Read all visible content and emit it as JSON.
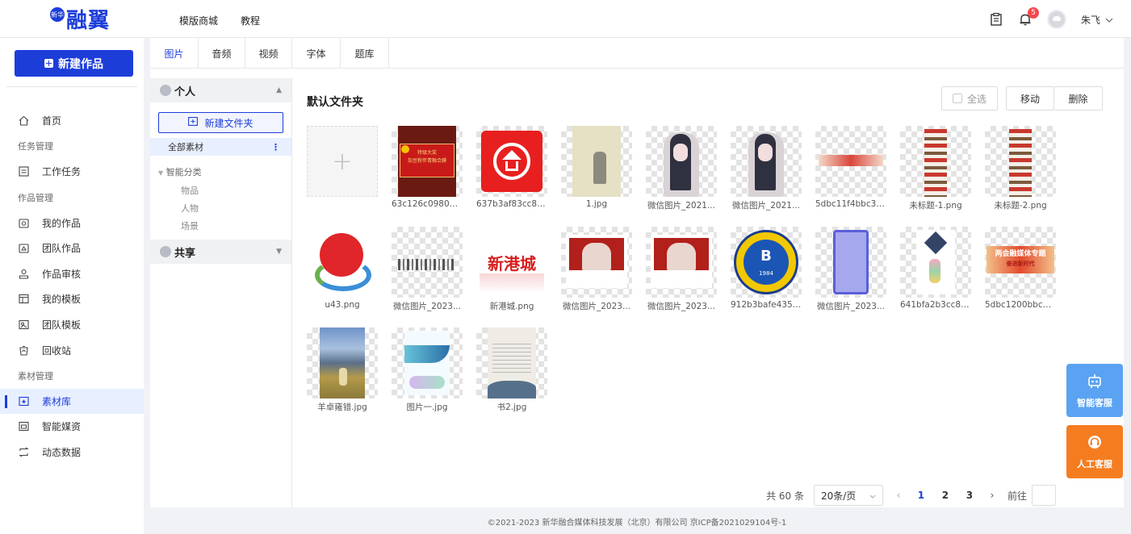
{
  "app": {
    "logo_text": "融翼",
    "logo_badge": "新华"
  },
  "topnav": {
    "items": [
      "模版商城",
      "教程"
    ]
  },
  "user": {
    "name": "朱飞",
    "notification_count": "5"
  },
  "sidebar": {
    "new_button": "新建作品",
    "home": "首页",
    "group_task": "任务管理",
    "work_tasks": "工作任务",
    "group_works": "作品管理",
    "my_works": "我的作品",
    "team_works": "团队作品",
    "review": "作品审核",
    "my_templates": "我的模板",
    "team_templates": "团队模板",
    "recycle": "回收站",
    "group_material": "素材管理",
    "library": "素材库",
    "media": "智能媒资",
    "dynamic": "动态数据"
  },
  "tabs": [
    "图片",
    "音频",
    "视频",
    "字体",
    "题库"
  ],
  "folders": {
    "personal": "个人",
    "new_folder": "新建文件夹",
    "all": "全部素材",
    "smart": "智能分类",
    "subs": [
      "物品",
      "人物",
      "场景"
    ],
    "shared": "共享"
  },
  "content": {
    "title": "默认文件夹",
    "select_all": "全选",
    "move": "移动",
    "delete": "删除",
    "items": [
      "63c126c0980bd...",
      "637b3af83cc89...",
      "1.jpg",
      "微信图片_2021...",
      "微信图片_2021...",
      "5dbc11f4bbc3e1...",
      "未标题-1.png",
      "未标题-2.png",
      "u43.png",
      "微信图片_2023...",
      "新港城.png",
      "微信图片_2023...",
      "微信图片_2023...",
      "912b3bafe4354...",
      "微信图片_2023...",
      "641bfa2b3cc89...",
      "5dbc1200bbc3e...",
      "羊卓雍错.jpg",
      "图片一.jpg",
      "书2.jpg"
    ],
    "thumb_text": {
      "sign1": "特级大奖",
      "sign2": "加豆粉伴青融合膜",
      "xgc": "新港城",
      "banner": "两会融媒体专题",
      "banner_sub": "奋进新时代",
      "badge_year": "1984",
      "badge_letter": "B"
    }
  },
  "pager": {
    "total": "共 60 条",
    "page_size": "20条/页",
    "pages": [
      "1",
      "2",
      "3"
    ],
    "jump": "前往"
  },
  "footer": "©2021-2023 新华融合媒体科技发展（北京）有限公司 京ICP备2021029104号-1",
  "float": {
    "ai": "智能客服",
    "human": "人工客服"
  },
  "colors": {
    "brand": "#1d3dd9",
    "badge": "#f5484c",
    "ai": "#5aa3f2",
    "human": "#f57d20"
  }
}
